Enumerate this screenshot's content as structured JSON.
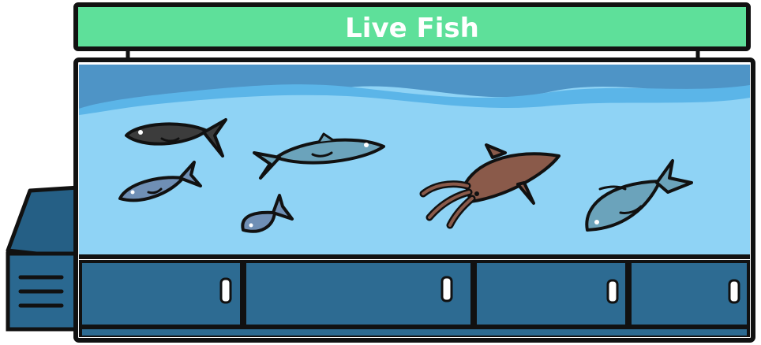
{
  "sign": {
    "title": "Live Fish",
    "color": "#5ee09a"
  },
  "colors": {
    "outline": "#111111",
    "water": "#8fd3f5",
    "water_surface": "#4e94c6",
    "water_highlight": "#5bb5e8",
    "cabinet": "#2d6b92",
    "side_unit": "#255f85",
    "fish_dark": "#3c3c3c",
    "fish_blue": "#6f8fb5",
    "fish_teal": "#6ba3bb",
    "squid": "#8a5a4a"
  },
  "tank": {
    "creatures": [
      {
        "name": "dark-fish-icon",
        "kind": "fish"
      },
      {
        "name": "teal-fish-icon",
        "kind": "fish"
      },
      {
        "name": "blue-fish-icon",
        "kind": "fish"
      },
      {
        "name": "small-fish-icon",
        "kind": "fish"
      },
      {
        "name": "squid-icon",
        "kind": "squid"
      },
      {
        "name": "big-fish-icon",
        "kind": "fish"
      }
    ]
  },
  "cabinet": {
    "doors": 4
  }
}
